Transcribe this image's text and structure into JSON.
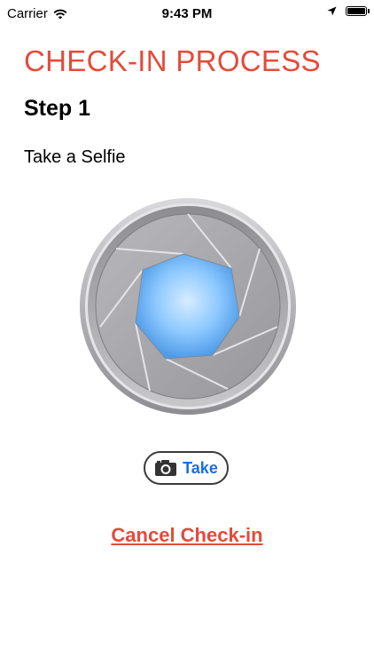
{
  "status_bar": {
    "carrier": "Carrier",
    "time": "9:43 PM",
    "icons": [
      "wifi-icon",
      "location-icon",
      "battery-icon"
    ]
  },
  "header": {
    "title": "CHECK-IN PROCESS",
    "step": "Step 1"
  },
  "main": {
    "instruction": "Take a Selfie",
    "image_icon": "camera-aperture-icon",
    "take_button": {
      "icon": "camera-icon",
      "label": "Take"
    },
    "cancel_label": "Cancel Check-in"
  },
  "colors": {
    "title": "#e34b3a",
    "cancel_link": "#e34b3a",
    "take_label": "#1a6fe0",
    "lens": "#8ec9ff"
  }
}
